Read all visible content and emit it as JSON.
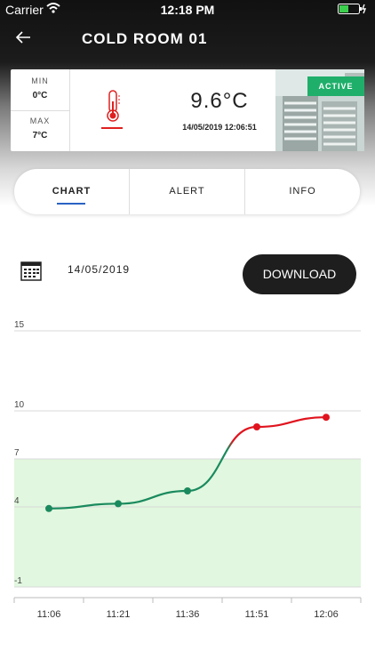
{
  "status": {
    "carrier": "Carrier",
    "time": "12:18 PM"
  },
  "header": {
    "title": "COLD ROOM 01"
  },
  "sensor": {
    "min_label": "MIN",
    "min_value": "0°C",
    "max_label": "MAX",
    "max_value": "7°C",
    "temperature": "9.6°C",
    "timestamp": "14/05/2019 12:06:51",
    "status_badge": "ACTIVE"
  },
  "tabs": [
    {
      "label": "CHART",
      "active": true
    },
    {
      "label": "ALERT",
      "active": false
    },
    {
      "label": "INFO",
      "active": false
    }
  ],
  "toolbar": {
    "date": "14/05/2019",
    "download_label": "DOWNLOAD"
  },
  "colors": {
    "ok": "#1a8a5e",
    "alarm": "#e0141e",
    "safe_band": "#e1f7df",
    "accent": "#2a63c4",
    "badge": "#1faf6b"
  },
  "chart_data": {
    "type": "line",
    "categories": [
      "11:06",
      "11:21",
      "11:36",
      "11:51",
      "12:06"
    ],
    "values": [
      3.9,
      4.2,
      5.0,
      9.0,
      9.6
    ],
    "yticks": [
      -1,
      4,
      7,
      10,
      15
    ],
    "ylim": [
      -1,
      15
    ],
    "safe_range": [
      -1,
      7
    ],
    "grid": true
  }
}
